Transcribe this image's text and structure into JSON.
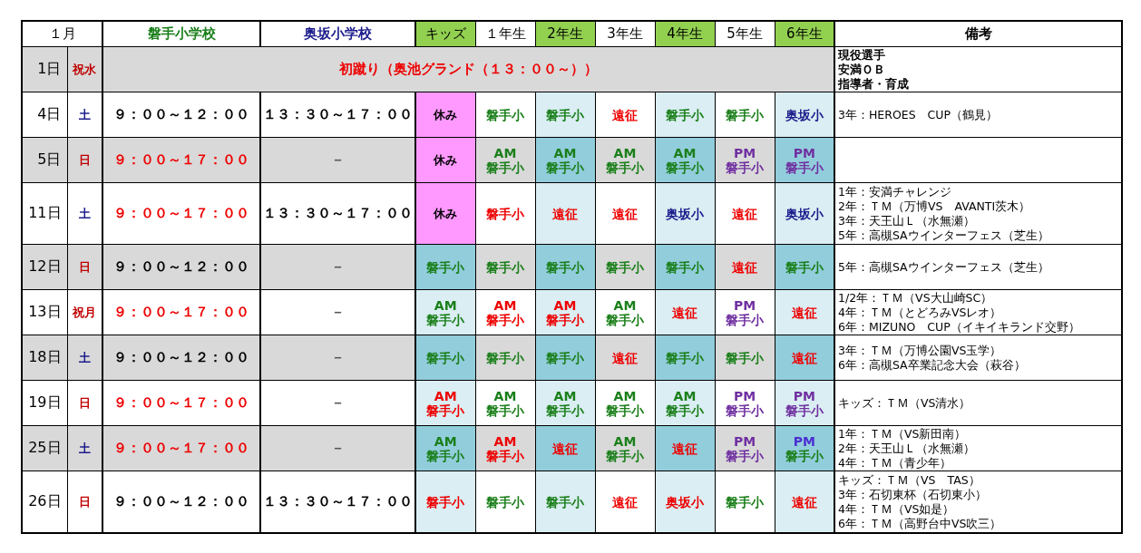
{
  "header": {
    "month": "１月",
    "schools": [
      {
        "name": "磐手小学校",
        "color": "#1a7f1a"
      },
      {
        "name": "奥坂小学校",
        "color": "#1c1c8c"
      }
    ],
    "grades": [
      {
        "label": "キッズ",
        "highlight": true
      },
      {
        "label": "１年生",
        "highlight": false
      },
      {
        "label": "2年生",
        "highlight": true
      },
      {
        "label": "3年生",
        "highlight": false
      },
      {
        "label": "4年生",
        "highlight": true
      },
      {
        "label": "5年生",
        "highlight": false
      },
      {
        "label": "6年生",
        "highlight": true
      }
    ],
    "notes": "備考"
  },
  "rows": [
    {
      "kind": "event",
      "date": "1日",
      "day": {
        "text": "祝水",
        "color": "#c00000"
      },
      "shaded": true,
      "event": {
        "text": "初蹴り（奥池グランド（１３：００～））",
        "color": "#ee0000"
      },
      "notes": [
        "現役選手",
        "安満ＯＢ",
        "指導者・育成"
      ]
    },
    {
      "kind": "schedule",
      "date": "4日",
      "day": {
        "text": "土",
        "color": "#1c1c8c"
      },
      "shaded": false,
      "times": [
        {
          "text": "９：００～１２：００",
          "color": "#000000"
        },
        {
          "text": "１３：３０～１７：００",
          "color": "#000000"
        }
      ],
      "cells": [
        {
          "kind": "rest",
          "lines": [
            {
              "text": "休み",
              "color": "#000000"
            }
          ]
        },
        {
          "kind": "entry",
          "lines": [
            {
              "text": "磐手小",
              "color": "#1a7f1a"
            }
          ]
        },
        {
          "kind": "entry",
          "lines": [
            {
              "text": "磐手小",
              "color": "#1a7f1a"
            }
          ]
        },
        {
          "kind": "entry",
          "lines": [
            {
              "text": "遠征",
              "color": "#ee0000"
            }
          ]
        },
        {
          "kind": "entry",
          "lines": [
            {
              "text": "磐手小",
              "color": "#1a7f1a"
            }
          ]
        },
        {
          "kind": "entry",
          "lines": [
            {
              "text": "磐手小",
              "color": "#1a7f1a"
            }
          ]
        },
        {
          "kind": "entry",
          "lines": [
            {
              "text": "奥坂小",
              "color": "#1c1c8c"
            }
          ]
        }
      ],
      "notes": [
        "3年：HEROES　CUP（鶴見）"
      ]
    },
    {
      "kind": "schedule",
      "date": "5日",
      "day": {
        "text": "日",
        "color": "#c00000"
      },
      "shaded": true,
      "times": [
        {
          "text": "９：００～１７：００",
          "color": "#ee0000"
        },
        {
          "text": "－",
          "color": "#555555"
        }
      ],
      "cells": [
        {
          "kind": "rest",
          "lines": [
            {
              "text": "休み",
              "color": "#000000"
            }
          ]
        },
        {
          "kind": "entry",
          "lines": [
            {
              "text": "AM",
              "color": "#1a7f1a"
            },
            {
              "text": "磐手小",
              "color": "#1a7f1a"
            }
          ]
        },
        {
          "kind": "entry",
          "lines": [
            {
              "text": "AM",
              "color": "#1a7f1a"
            },
            {
              "text": "磐手小",
              "color": "#1a7f1a"
            }
          ]
        },
        {
          "kind": "entry",
          "lines": [
            {
              "text": "AM",
              "color": "#1a7f1a"
            },
            {
              "text": "磐手小",
              "color": "#1a7f1a"
            }
          ]
        },
        {
          "kind": "entry",
          "lines": [
            {
              "text": "AM",
              "color": "#1a7f1a"
            },
            {
              "text": "磐手小",
              "color": "#1a7f1a"
            }
          ]
        },
        {
          "kind": "entry",
          "lines": [
            {
              "text": "PM",
              "color": "#7030a0"
            },
            {
              "text": "磐手小",
              "color": "#7030a0"
            }
          ]
        },
        {
          "kind": "entry",
          "lines": [
            {
              "text": "PM",
              "color": "#7030a0"
            },
            {
              "text": "磐手小",
              "color": "#7030a0"
            }
          ]
        }
      ],
      "notes": []
    },
    {
      "kind": "schedule",
      "date": "11日",
      "day": {
        "text": "土",
        "color": "#1c1c8c"
      },
      "shaded": false,
      "times": [
        {
          "text": "９：００～１７：００",
          "color": "#ee0000"
        },
        {
          "text": "１３：３０～１７：００",
          "color": "#000000"
        }
      ],
      "cells": [
        {
          "kind": "rest",
          "lines": [
            {
              "text": "休み",
              "color": "#000000"
            }
          ]
        },
        {
          "kind": "entry",
          "lines": [
            {
              "text": "磐手小",
              "color": "#ee0000"
            }
          ]
        },
        {
          "kind": "entry",
          "lines": [
            {
              "text": "遠征",
              "color": "#ee0000"
            }
          ]
        },
        {
          "kind": "entry",
          "lines": [
            {
              "text": "遠征",
              "color": "#ee0000"
            }
          ]
        },
        {
          "kind": "entry",
          "lines": [
            {
              "text": "奥坂小",
              "color": "#1c1c8c"
            }
          ]
        },
        {
          "kind": "entry",
          "lines": [
            {
              "text": "遠征",
              "color": "#ee0000"
            }
          ]
        },
        {
          "kind": "entry",
          "lines": [
            {
              "text": "奥坂小",
              "color": "#1c1c8c"
            }
          ]
        }
      ],
      "notes": [
        "1年：安満チャレンジ",
        "2年：ＴＭ（万博VS　AVANTI茨木）",
        "3年：天王山Ｌ（水無瀬）",
        "5年：高槻SAウインターフェス（芝生）"
      ]
    },
    {
      "kind": "schedule",
      "date": "12日",
      "day": {
        "text": "日",
        "color": "#c00000"
      },
      "shaded": true,
      "times": [
        {
          "text": "９：００～１２：００",
          "color": "#000000"
        },
        {
          "text": "－",
          "color": "#555555"
        }
      ],
      "cells": [
        {
          "kind": "entry",
          "lines": [
            {
              "text": "磐手小",
              "color": "#1a7f1a"
            }
          ]
        },
        {
          "kind": "entry",
          "lines": [
            {
              "text": "磐手小",
              "color": "#1a7f1a"
            }
          ]
        },
        {
          "kind": "entry",
          "lines": [
            {
              "text": "磐手小",
              "color": "#1a7f1a"
            }
          ]
        },
        {
          "kind": "entry",
          "lines": [
            {
              "text": "磐手小",
              "color": "#1a7f1a"
            }
          ]
        },
        {
          "kind": "entry",
          "lines": [
            {
              "text": "磐手小",
              "color": "#1a7f1a"
            }
          ]
        },
        {
          "kind": "entry",
          "lines": [
            {
              "text": "遠征",
              "color": "#ee0000"
            }
          ]
        },
        {
          "kind": "entry",
          "lines": [
            {
              "text": "磐手小",
              "color": "#1a7f1a"
            }
          ]
        }
      ],
      "notes": [
        "5年：高槻SAウインターフェス（芝生）"
      ]
    },
    {
      "kind": "schedule",
      "date": "13日",
      "day": {
        "text": "祝月",
        "color": "#c00000"
      },
      "shaded": false,
      "times": [
        {
          "text": "９：００～１７：００",
          "color": "#ee0000"
        },
        {
          "text": "－",
          "color": "#555555"
        }
      ],
      "cells": [
        {
          "kind": "entry",
          "lines": [
            {
              "text": "AM",
              "color": "#1a7f1a"
            },
            {
              "text": "磐手小",
              "color": "#1a7f1a"
            }
          ]
        },
        {
          "kind": "entry",
          "lines": [
            {
              "text": "AM",
              "color": "#ee0000"
            },
            {
              "text": "磐手小",
              "color": "#ee0000"
            }
          ]
        },
        {
          "kind": "entry",
          "lines": [
            {
              "text": "AM",
              "color": "#ee0000"
            },
            {
              "text": "磐手小",
              "color": "#ee0000"
            }
          ]
        },
        {
          "kind": "entry",
          "lines": [
            {
              "text": "AM",
              "color": "#1a7f1a"
            },
            {
              "text": "磐手小",
              "color": "#1a7f1a"
            }
          ]
        },
        {
          "kind": "entry",
          "lines": [
            {
              "text": "遠征",
              "color": "#ee0000"
            }
          ]
        },
        {
          "kind": "entry",
          "lines": [
            {
              "text": "PM",
              "color": "#7030a0"
            },
            {
              "text": "磐手小",
              "color": "#7030a0"
            }
          ]
        },
        {
          "kind": "entry",
          "lines": [
            {
              "text": "遠征",
              "color": "#ee0000"
            }
          ]
        }
      ],
      "notes": [
        "1/2年：ＴＭ（VS大山崎SC）",
        "4年：ＴＭ（とどろみVSレオ）",
        "6年：MIZUNO　CUP（イキイキランド交野）"
      ]
    },
    {
      "kind": "schedule",
      "date": "18日",
      "day": {
        "text": "土",
        "color": "#1c1c8c"
      },
      "shaded": true,
      "times": [
        {
          "text": "９：００～１２：００",
          "color": "#000000"
        },
        {
          "text": "－",
          "color": "#555555"
        }
      ],
      "cells": [
        {
          "kind": "entry",
          "lines": [
            {
              "text": "磐手小",
              "color": "#1a7f1a"
            }
          ]
        },
        {
          "kind": "entry",
          "lines": [
            {
              "text": "磐手小",
              "color": "#1a7f1a"
            }
          ]
        },
        {
          "kind": "entry",
          "lines": [
            {
              "text": "磐手小",
              "color": "#1a7f1a"
            }
          ]
        },
        {
          "kind": "entry",
          "lines": [
            {
              "text": "遠征",
              "color": "#ee0000"
            }
          ]
        },
        {
          "kind": "entry",
          "lines": [
            {
              "text": "磐手小",
              "color": "#1a7f1a"
            }
          ]
        },
        {
          "kind": "entry",
          "lines": [
            {
              "text": "磐手小",
              "color": "#1a7f1a"
            }
          ]
        },
        {
          "kind": "entry",
          "lines": [
            {
              "text": "遠征",
              "color": "#ee0000"
            }
          ]
        }
      ],
      "notes": [
        "3年：ＴＭ（万博公園VS玉学）",
        "6年：高槻SA卒業記念大会（萩谷）"
      ]
    },
    {
      "kind": "schedule",
      "date": "19日",
      "day": {
        "text": "日",
        "color": "#c00000"
      },
      "shaded": false,
      "times": [
        {
          "text": "９：００～１７：００",
          "color": "#ee0000"
        },
        {
          "text": "－",
          "color": "#555555"
        }
      ],
      "cells": [
        {
          "kind": "entry",
          "lines": [
            {
              "text": "AM",
              "color": "#ee0000"
            },
            {
              "text": "磐手小",
              "color": "#ee0000"
            }
          ]
        },
        {
          "kind": "entry",
          "lines": [
            {
              "text": "AM",
              "color": "#1a7f1a"
            },
            {
              "text": "磐手小",
              "color": "#1a7f1a"
            }
          ]
        },
        {
          "kind": "entry",
          "lines": [
            {
              "text": "AM",
              "color": "#1a7f1a"
            },
            {
              "text": "磐手小",
              "color": "#1a7f1a"
            }
          ]
        },
        {
          "kind": "entry",
          "lines": [
            {
              "text": "AM",
              "color": "#1a7f1a"
            },
            {
              "text": "磐手小",
              "color": "#1a7f1a"
            }
          ]
        },
        {
          "kind": "entry",
          "lines": [
            {
              "text": "AM",
              "color": "#1a7f1a"
            },
            {
              "text": "磐手小",
              "color": "#1a7f1a"
            }
          ]
        },
        {
          "kind": "entry",
          "lines": [
            {
              "text": "PM",
              "color": "#7030a0"
            },
            {
              "text": "磐手小",
              "color": "#7030a0"
            }
          ]
        },
        {
          "kind": "entry",
          "lines": [
            {
              "text": "PM",
              "color": "#7030a0"
            },
            {
              "text": "磐手小",
              "color": "#7030a0"
            }
          ]
        }
      ],
      "notes": [
        "キッズ：ＴＭ（VS清水）"
      ]
    },
    {
      "kind": "schedule",
      "date": "25日",
      "day": {
        "text": "土",
        "color": "#1c1c8c"
      },
      "shaded": true,
      "times": [
        {
          "text": "９：００～１７：００",
          "color": "#ee0000"
        },
        {
          "text": "－",
          "color": "#555555"
        }
      ],
      "cells": [
        {
          "kind": "entry",
          "lines": [
            {
              "text": "AM",
              "color": "#1a7f1a"
            },
            {
              "text": "磐手小",
              "color": "#1a7f1a"
            }
          ]
        },
        {
          "kind": "entry",
          "lines": [
            {
              "text": "AM",
              "color": "#ee0000"
            },
            {
              "text": "磐手小",
              "color": "#ee0000"
            }
          ]
        },
        {
          "kind": "entry",
          "lines": [
            {
              "text": "遠征",
              "color": "#ee0000"
            }
          ]
        },
        {
          "kind": "entry",
          "lines": [
            {
              "text": "AM",
              "color": "#1a7f1a"
            },
            {
              "text": "磐手小",
              "color": "#1a7f1a"
            }
          ]
        },
        {
          "kind": "entry",
          "lines": [
            {
              "text": "遠征",
              "color": "#ee0000"
            }
          ]
        },
        {
          "kind": "entry",
          "lines": [
            {
              "text": "PM",
              "color": "#7030a0"
            },
            {
              "text": "磐手小",
              "color": "#7030a0"
            }
          ]
        },
        {
          "kind": "entry",
          "lines": [
            {
              "text": "PM",
              "color": "#4b2fd0"
            },
            {
              "text": "磐手小",
              "color": "#1a7f1a"
            }
          ]
        }
      ],
      "notes": [
        "1年：ＴＭ（VS新田南）",
        "2年：天王山Ｌ（水無瀬）",
        "4年：ＴＭ（青少年）"
      ]
    },
    {
      "kind": "schedule",
      "date": "26日",
      "day": {
        "text": "日",
        "color": "#c00000"
      },
      "shaded": false,
      "times": [
        {
          "text": "９：００～１２：００",
          "color": "#000000"
        },
        {
          "text": "１３：３０～１７：００",
          "color": "#000000"
        }
      ],
      "cells": [
        {
          "kind": "entry",
          "lines": [
            {
              "text": "磐手小",
              "color": "#ee0000"
            }
          ]
        },
        {
          "kind": "entry",
          "lines": [
            {
              "text": "磐手小",
              "color": "#1a7f1a"
            }
          ]
        },
        {
          "kind": "entry",
          "lines": [
            {
              "text": "磐手小",
              "color": "#1a7f1a"
            }
          ]
        },
        {
          "kind": "entry",
          "lines": [
            {
              "text": "遠征",
              "color": "#ee0000"
            }
          ]
        },
        {
          "kind": "entry",
          "lines": [
            {
              "text": "奥坂小",
              "color": "#ee0000"
            }
          ]
        },
        {
          "kind": "entry",
          "lines": [
            {
              "text": "磐手小",
              "color": "#1a7f1a"
            }
          ]
        },
        {
          "kind": "entry",
          "lines": [
            {
              "text": "遠征",
              "color": "#ee0000"
            }
          ]
        }
      ],
      "notes": [
        "キッズ：ＴＭ（VS　TAS）",
        "3年：石切東杯（石切東小）",
        "4年：ＴＭ（VS如是）",
        "6年：ＴＭ（高野台中VS吹三）"
      ]
    }
  ]
}
